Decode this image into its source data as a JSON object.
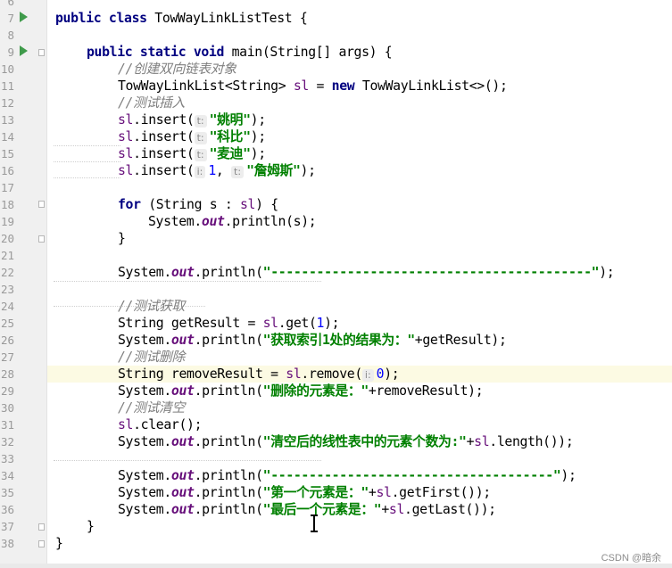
{
  "line_numbers": [
    "6",
    "7",
    "8",
    "9",
    "10",
    "11",
    "12",
    "13",
    "14",
    "15",
    "16",
    "17",
    "18",
    "19",
    "20",
    "21",
    "22",
    "23",
    "24",
    "25",
    "26",
    "27",
    "28",
    "29",
    "30",
    "31",
    "32",
    "33",
    "34",
    "35",
    "36",
    "37",
    "38"
  ],
  "code": {
    "l7_kw": "public class",
    "l7_rest": " TowWayLinkListTest {",
    "l9_kw1": "public static void",
    "l9_rest": " main(String[] args) {",
    "l10_comment": "//创建双向链表对象",
    "l11_a": "TowWayLinkList<String> ",
    "l11_var": "sl",
    "l11_b": " = ",
    "l11_kw": "new",
    "l11_c": " TowWayLinkList<>();",
    "l12_comment": "//测试插入",
    "insert_call": ".insert(",
    "hint_t": "t:",
    "hint_i": "i:",
    "l13_str": "\"姚明\"",
    "l14_str": "\"科比\"",
    "l15_str": "\"麦迪\"",
    "l16_num": "1",
    "l16_comma": ", ",
    "l16_str": "\"詹姆斯\"",
    "close_stmt": ");",
    "l18_kw": "for",
    "l18_a": " (String s : ",
    "l18_b": ") {",
    "l19_a": "System.",
    "out": "out",
    "l19_b": ".println(s);",
    "close_brace": "}",
    "println_open": ".println(",
    "sys": "System.",
    "l22_str": "\"------------------------------------------\"",
    "l24_comment": "//测试获取",
    "l25_a": "String getResult = ",
    "l25_b": ".get(",
    "l25_num": "1",
    "l26_str": "\"获取索引1处的结果为：\"",
    "l26_b": "+getResult);",
    "l27_comment": "//测试删除",
    "l28_a": "String removeResult = ",
    "l28_b": ".remove(",
    "l28_num": "0",
    "l29_str": "\"删除的元素是：\"",
    "l29_b": "+removeResult);",
    "l30_comment": "//测试清空",
    "l31_b": ".clear();",
    "l32_str": "\"清空后的线性表中的元素个数为:\"",
    "plus": "+",
    "l32_b": ".length());",
    "l34_str": "\"-------------------------------------\"",
    "l35_str": "\"第一个元素是：\"",
    "l35_b": ".getFirst());",
    "l36_str": "\"最后一个元素是：\"",
    "l36_b": ".getLast());",
    "sl": "sl"
  },
  "watermark": "CSDN @暗余",
  "colors": {
    "keyword": "#000080",
    "comment": "#808080",
    "string": "#008000",
    "field": "#660e7a",
    "number": "#0000ff",
    "run_icon": "#3f9b4b"
  }
}
